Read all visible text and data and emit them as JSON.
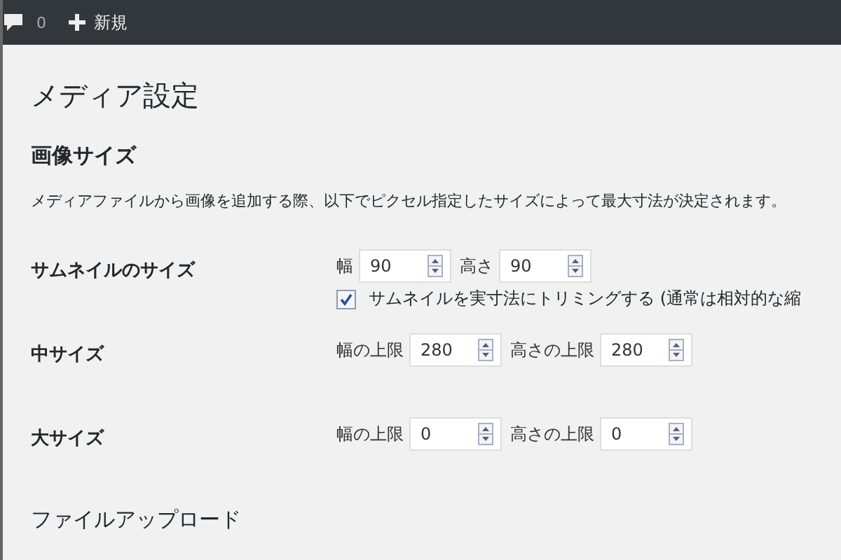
{
  "toolbar": {
    "comments_count": "0",
    "new_label": "新規"
  },
  "page_title": "メディア設定",
  "section_title": "画像サイズ",
  "description": "メディアファイルから画像を追加する際、以下でピクセル指定したサイズによって最大寸法が決定されます。",
  "rows": [
    {
      "label": "サムネイルのサイズ",
      "fields": [
        {
          "label": "幅",
          "value": "90"
        },
        {
          "label": "高さ",
          "value": "90"
        }
      ],
      "checkbox": {
        "label": "サムネイルを実寸法にトリミングする (通常は相対的な縮",
        "checked": true
      }
    },
    {
      "label": "中サイズ",
      "fields": [
        {
          "label": "幅の上限",
          "value": "280"
        },
        {
          "label": "高さの上限",
          "value": "280"
        }
      ]
    },
    {
      "label": "大サイズ",
      "fields": [
        {
          "label": "幅の上限",
          "value": "0"
        },
        {
          "label": "高さの上限",
          "value": "0"
        }
      ]
    }
  ],
  "next_section_title": "ファイルアップロード"
}
